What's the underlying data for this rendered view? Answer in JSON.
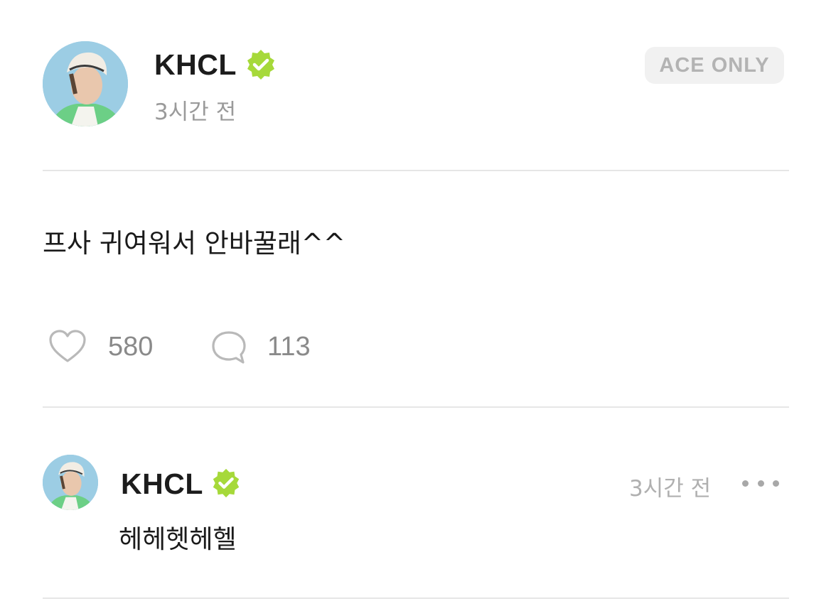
{
  "post": {
    "author": "KHCL",
    "time": "3시간 전",
    "access_badge": "ACE ONLY",
    "text": "프사 귀여워서 안바꿀래^^",
    "likes": "580",
    "comments": "113"
  },
  "comment": {
    "author": "KHCL",
    "time": "3시간 전",
    "text": "헤헤헷헤헬"
  },
  "colors": {
    "verified_badge": "#a6d93a",
    "divider": "#e6e6e6",
    "muted_text": "#9a9a9a"
  },
  "icons": {
    "verified": "verified-badge-icon",
    "like": "heart-icon",
    "comment": "speech-bubble-icon",
    "more": "more-dots-icon"
  }
}
